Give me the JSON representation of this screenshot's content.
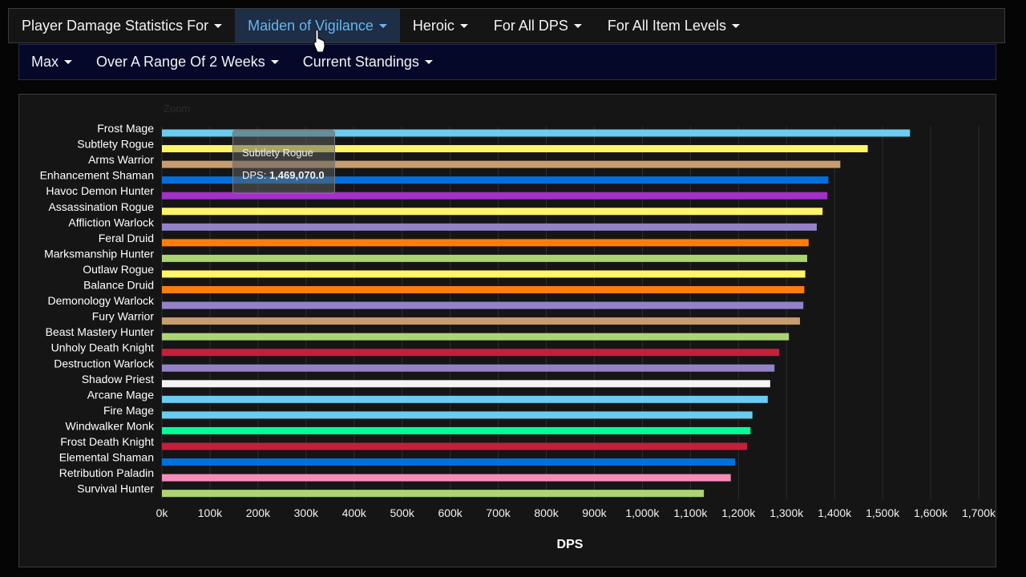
{
  "nav": {
    "top": [
      {
        "label": "Player Damage Statistics For",
        "active": false
      },
      {
        "label": "Maiden of Vigilance",
        "active": true
      },
      {
        "label": "Heroic",
        "active": false
      },
      {
        "label": "For All DPS",
        "active": false
      },
      {
        "label": "For All Item Levels",
        "active": false
      }
    ],
    "sub": [
      {
        "label": "Max"
      },
      {
        "label": "Over A Range Of 2 Weeks"
      },
      {
        "label": "Current Standings"
      }
    ]
  },
  "zoom_label": "Zoom",
  "tooltip": {
    "name": "Subtlety Rogue",
    "metric_label": "DPS:",
    "value": "1,469,070.0"
  },
  "chart_data": {
    "type": "bar",
    "orientation": "horizontal",
    "xlabel": "DPS",
    "ylabel": "",
    "xlim": [
      0,
      1700000
    ],
    "xticks": [
      "0k",
      "100k",
      "200k",
      "300k",
      "400k",
      "500k",
      "600k",
      "700k",
      "800k",
      "900k",
      "1,000k",
      "1,100k",
      "1,200k",
      "1,300k",
      "1,400k",
      "1,500k",
      "1,600k",
      "1,700k"
    ],
    "grid": true,
    "categories": [
      "Frost Mage",
      "Subtlety Rogue",
      "Arms Warrior",
      "Enhancement Shaman",
      "Havoc Demon Hunter",
      "Assassination Rogue",
      "Affliction Warlock",
      "Feral Druid",
      "Marksmanship Hunter",
      "Outlaw Rogue",
      "Balance Druid",
      "Demonology Warlock",
      "Fury Warrior",
      "Beast Mastery Hunter",
      "Unholy Death Knight",
      "Destruction Warlock",
      "Shadow Priest",
      "Arcane Mage",
      "Fire Mage",
      "Windwalker Monk",
      "Frost Death Knight",
      "Elemental Shaman",
      "Retribution Paladin",
      "Survival Hunter"
    ],
    "values": [
      1557000,
      1469070,
      1412000,
      1387000,
      1385000,
      1375000,
      1363000,
      1346000,
      1343000,
      1339000,
      1337000,
      1335000,
      1328000,
      1305000,
      1285000,
      1275000,
      1266000,
      1261000,
      1229000,
      1225000,
      1218000,
      1193000,
      1184000,
      1128000
    ],
    "colors": [
      "#69ccf0",
      "#fff569",
      "#c79c6e",
      "#0070de",
      "#a330c9",
      "#fff569",
      "#9482c9",
      "#ff7d0a",
      "#abd473",
      "#fff569",
      "#ff7d0a",
      "#9482c9",
      "#c79c6e",
      "#abd473",
      "#c41f3b",
      "#9482c9",
      "#f4f4f4",
      "#69ccf0",
      "#69ccf0",
      "#00ff96",
      "#c41f3b",
      "#0070de",
      "#f58cba",
      "#abd473"
    ]
  }
}
